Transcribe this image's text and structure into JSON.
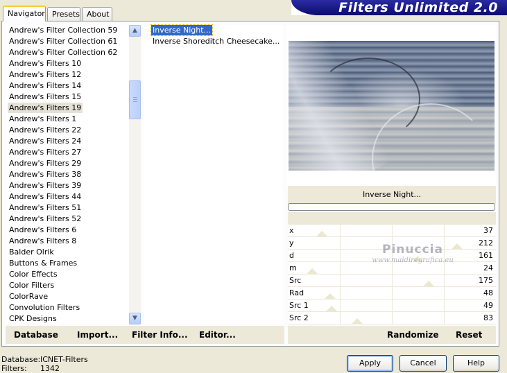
{
  "tabs": [
    {
      "label": "Navigator",
      "active": true
    },
    {
      "label": "Presets",
      "active": false
    },
    {
      "label": "About",
      "active": false
    }
  ],
  "banner": {
    "title": "Filters Unlimited 2.0"
  },
  "categories": [
    "Andrew's Filter Collection 59",
    "Andrew's Filter Collection 61",
    "Andrew's Filter Collection 62",
    "Andrew's Filters 10",
    "Andrew's Filters 12",
    "Andrew's Filters 14",
    "Andrew's Filters 15",
    "Andrew's Filters 19",
    "Andrew's Filters 1",
    "Andrew's Filters 22",
    "Andrew's Filters 24",
    "Andrew's Filters 27",
    "Andrew's Filters 29",
    "Andrew's Filters 38",
    "Andrew's Filters 39",
    "Andrew's Filters 44",
    "Andrew's Filters 51",
    "Andrew's Filters 52",
    "Andrew's Filters 6",
    "Andrew's Filters 8",
    "Balder Olrik",
    "Buttons & Frames",
    "Color Effects",
    "Color Filters",
    "ColorRave",
    "Convolution Filters",
    "CPK Designs"
  ],
  "selected_category": "Andrew's Filters 19",
  "filters": [
    "Inverse Night...",
    "Inverse Shoreditch Cheesecake..."
  ],
  "selected_filter": "Inverse Night...",
  "preview": {
    "filter_name": "Inverse Night..."
  },
  "sliders": [
    {
      "label": "x",
      "value": "37",
      "level": 37
    },
    {
      "label": "y",
      "value": "212",
      "level": 212
    },
    {
      "label": "d",
      "value": "161",
      "level": 161
    },
    {
      "label": "m",
      "value": "24",
      "level": 24
    },
    {
      "label": "Src",
      "value": "175",
      "level": 175
    },
    {
      "label": "Rad",
      "value": "48",
      "level": 48
    },
    {
      "label": "Src 1",
      "value": "49",
      "level": 49
    },
    {
      "label": "Src 2",
      "value": "83",
      "level": 83
    }
  ],
  "toolbar": {
    "database": "Database",
    "import": "Import...",
    "filter_info": "Filter Info...",
    "editor": "Editor...",
    "randomize": "Randomize",
    "reset": "Reset"
  },
  "status": {
    "database_label": "Database:",
    "database_value": "ICNET-Filters",
    "filters_label": "Filters:",
    "filters_value": "1342"
  },
  "buttons": {
    "apply": "Apply",
    "cancel": "Cancel",
    "help": "Help"
  },
  "watermark": {
    "name": "Pinuccia",
    "site": "www.maidiregrafica.eu"
  }
}
